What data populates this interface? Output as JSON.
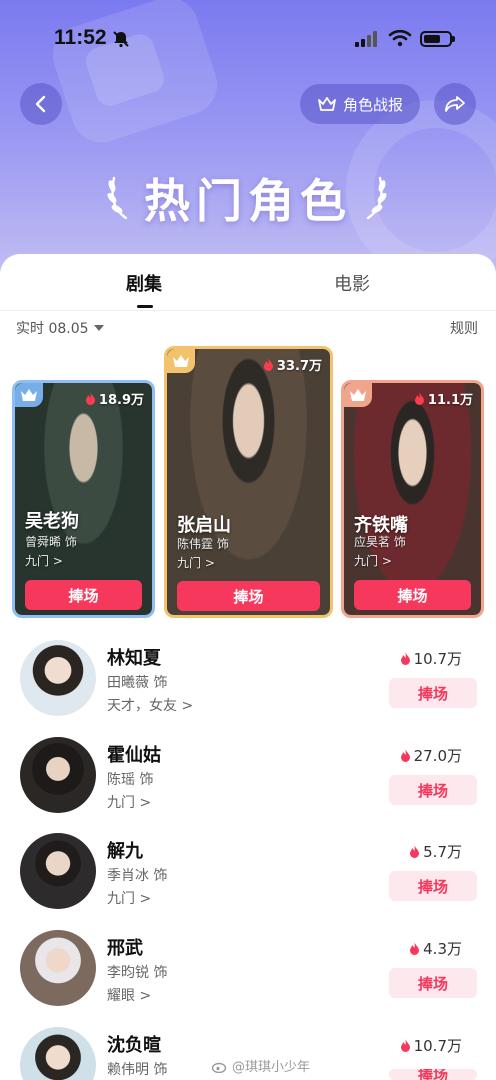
{
  "status_bar": {
    "time": "11:52"
  },
  "header": {
    "report_label": "角色战报",
    "title": "热门角色"
  },
  "tabs": [
    {
      "label": "剧集",
      "active": true
    },
    {
      "label": "电影",
      "active": false
    }
  ],
  "filter": {
    "label": "实时 08.05",
    "rules_label": "规则"
  },
  "podium": [
    {
      "rank": 1,
      "name": "张启山",
      "actor": "陈伟霆 饰",
      "drama": "九门 >",
      "heat": "33.7万",
      "cheer_label": "捧场"
    },
    {
      "rank": 2,
      "name": "吴老狗",
      "actor": "曾舜晞 饰",
      "drama": "九门 >",
      "heat": "18.9万",
      "cheer_label": "捧场"
    },
    {
      "rank": 3,
      "name": "齐铁嘴",
      "actor": "应昊茗 饰",
      "drama": "九门 >",
      "heat": "11.1万",
      "cheer_label": "捧场"
    }
  ],
  "list": [
    {
      "name": "林知夏",
      "actor": "田曦薇 饰",
      "drama": "天才，女友 >",
      "heat": "10.7万",
      "cheer_label": "捧场"
    },
    {
      "name": "霍仙姑",
      "actor": "陈瑶 饰",
      "drama": "九门 >",
      "heat": "27.0万",
      "cheer_label": "捧场"
    },
    {
      "name": "解九",
      "actor": "季肖冰 饰",
      "drama": "九门 >",
      "heat": "5.7万",
      "cheer_label": "捧场"
    },
    {
      "name": "邢武",
      "actor": "李昀锐 饰",
      "drama": "耀眼 >",
      "heat": "4.3万",
      "cheer_label": "捧场"
    },
    {
      "name": "沈负暄",
      "actor": "赖伟明 饰",
      "drama": "",
      "heat": "10.7万",
      "cheer_label": "捧场"
    }
  ],
  "watermark": "@琪琪小少年",
  "colors": {
    "accent": "#f6385c",
    "hero_start": "#7b7af0",
    "gold": "#f2c36c",
    "silver": "#8fbff2",
    "bronze": "#f0a58c"
  }
}
